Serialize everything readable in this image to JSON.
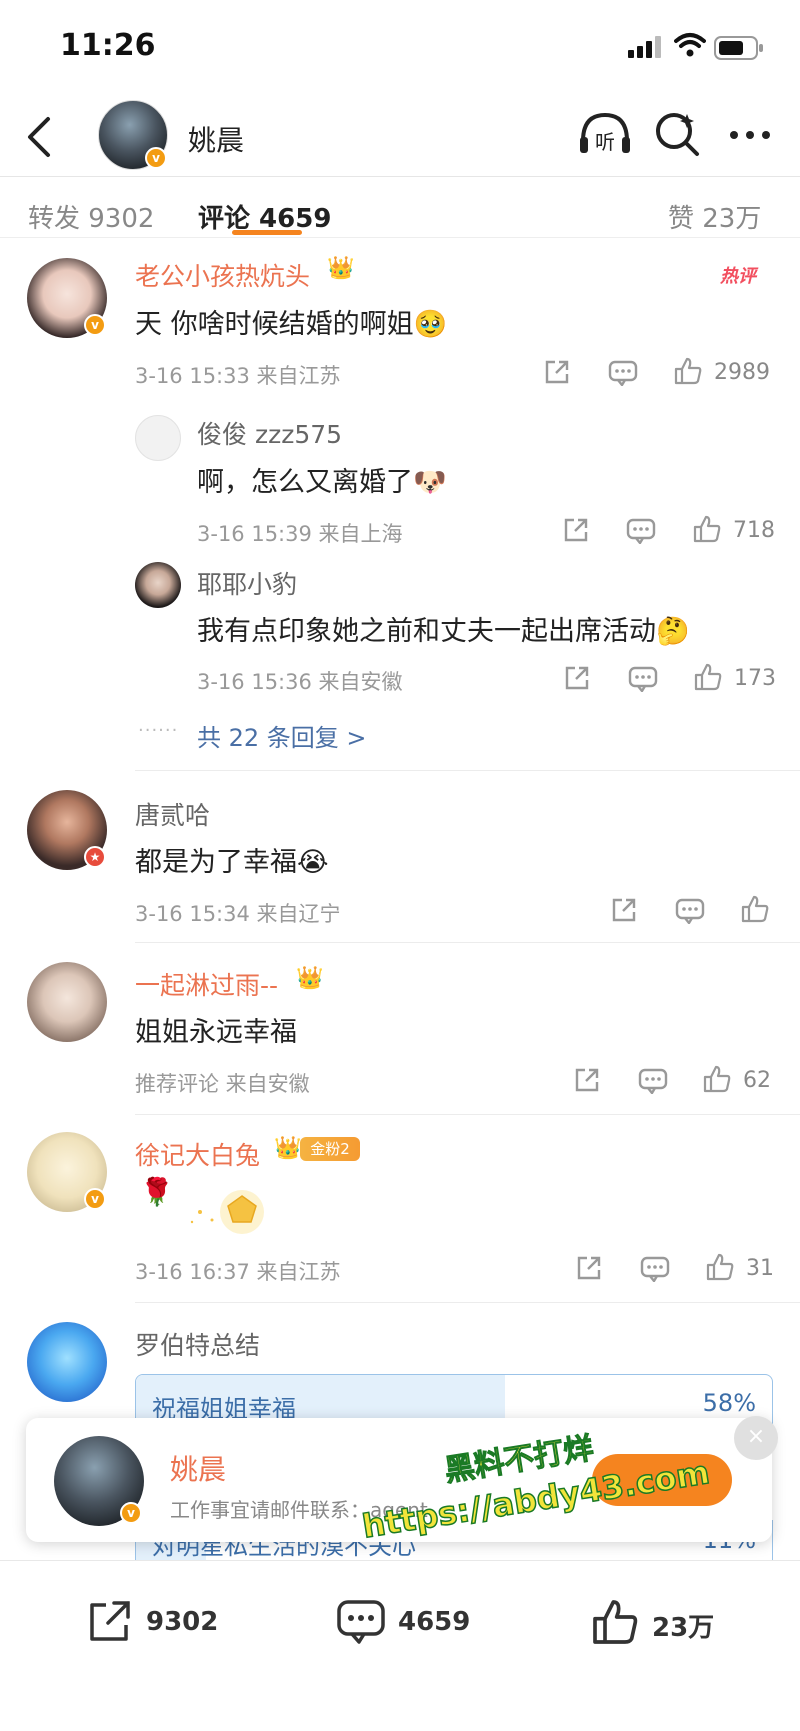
{
  "status_bar": {
    "time": "11:26"
  },
  "header": {
    "name": "姚晨"
  },
  "tabs": {
    "repost": "转发 9302",
    "comments": "评论 4659",
    "likes": "赞 23万"
  },
  "comments": [
    {
      "user": "老公小孩热炕头",
      "hot_tag": "热评",
      "text": "天 你啥时候结婚的啊姐",
      "emoji": "🥹",
      "meta": "3-16 15:33 来自江苏",
      "likes": "2989",
      "replies": [
        {
          "user": "俊俊 zzz575",
          "text": "啊，怎么又离婚了",
          "emoji": "🐶",
          "meta": "3-16 15:39 来自上海",
          "likes": "718"
        },
        {
          "user": "耶耶小豹",
          "text": "我有点印象她之前和丈夫一起出席活动",
          "emoji": "🤔",
          "meta": "3-16 15:36 来自安徽",
          "likes": "173"
        }
      ],
      "more_replies": "共 22 条回复 >"
    },
    {
      "user": "唐贰哈",
      "text": "都是为了幸福",
      "emoji": "😭",
      "meta": "3-16 15:34 来自辽宁",
      "likes": ""
    },
    {
      "user": "一起淋过雨--",
      "text": "姐姐永远幸福",
      "meta": "推荐评论 来自安徽",
      "likes": "62"
    },
    {
      "user": "徐记大白兔",
      "fan_badge": "金粉2",
      "text": "🌹",
      "meta": "3-16 16:37 来自江苏",
      "likes": "31"
    },
    {
      "user": "罗伯特总结",
      "poll": [
        {
          "label": "祝福姐姐幸福",
          "percent": "58%",
          "fraction": 0.58
        },
        {
          "label": "对明星私生活的漠不关心",
          "percent": "11%",
          "fraction": 0.11
        }
      ]
    }
  ],
  "popup": {
    "name": "姚晨",
    "subtitle": "工作事宜请邮件联系：agent",
    "close": "×"
  },
  "watermark": {
    "line1": "黑料不打烊",
    "line2": "https://abdy43.com"
  },
  "bottom_bar": {
    "repost_count": "9302",
    "comment_count": "4659",
    "like_count": "23万"
  },
  "colors": {
    "accent": "#f5841f",
    "username_orange": "#eb7350",
    "link_blue": "#4a6fa5"
  }
}
